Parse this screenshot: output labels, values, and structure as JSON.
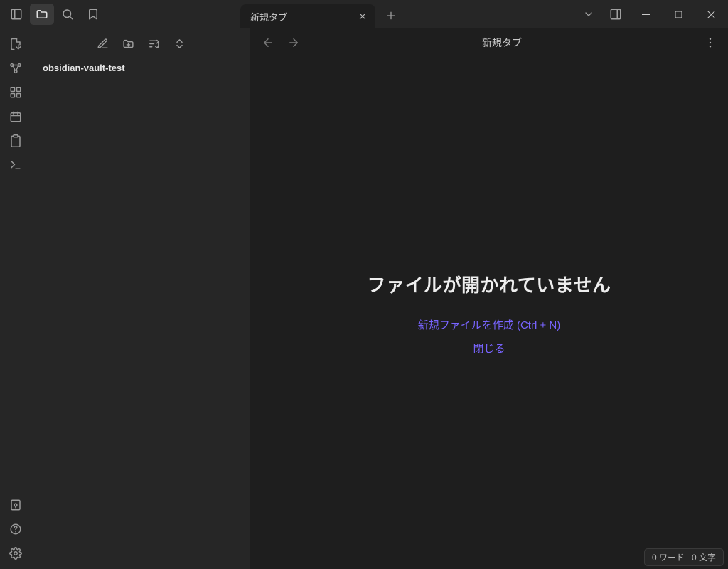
{
  "titlebar": {
    "tab_label": "新規タブ"
  },
  "sidebar": {
    "vault_name": "obsidian-vault-test"
  },
  "view": {
    "header_title": "新規タブ"
  },
  "empty": {
    "heading": "ファイルが開かれていません",
    "create_label": "新規ファイルを作成 (Ctrl + N)",
    "close_label": "閉じる"
  },
  "status": {
    "words": "0 ワード",
    "chars": "0 文字"
  }
}
